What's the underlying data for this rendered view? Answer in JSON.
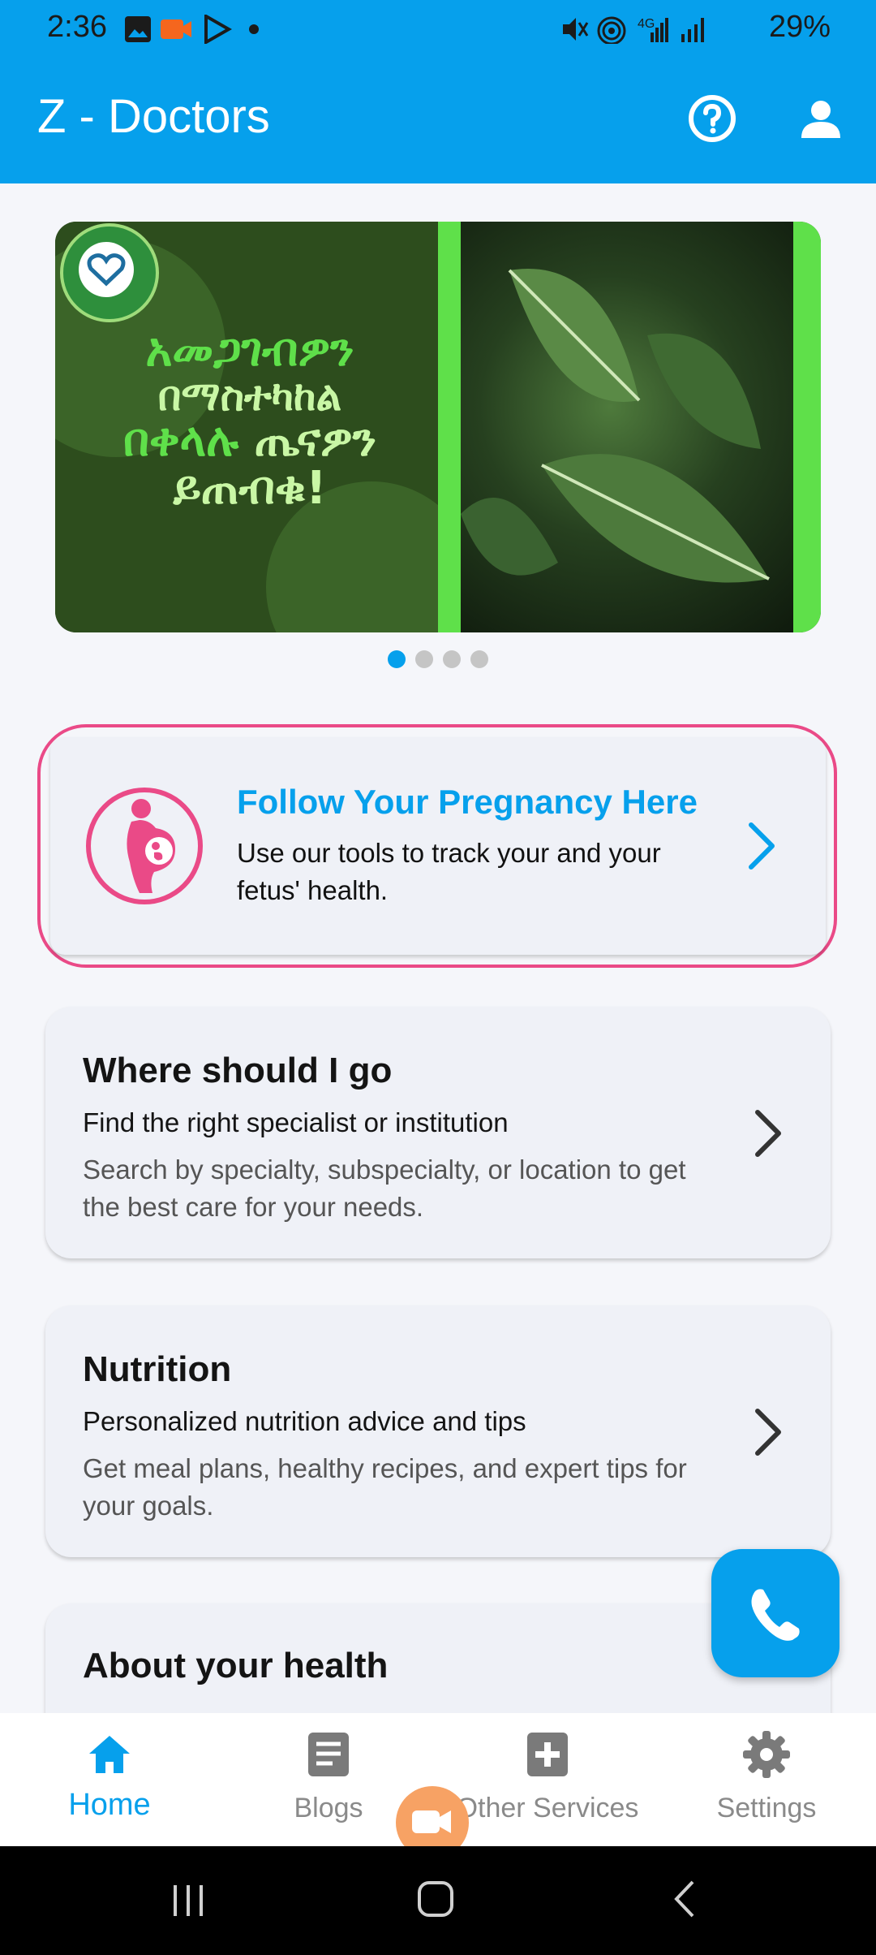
{
  "status": {
    "time": "2:36",
    "battery": "29%"
  },
  "appbar": {
    "title": "Z - Doctors",
    "help_icon": "help-circle-icon",
    "profile_icon": "person-icon"
  },
  "banner": {
    "lines": [
      "አመጋገብዎን",
      "በማስተካከል",
      "በቀላሉ",
      "ጤናዎን",
      "ይጠብቁ!"
    ],
    "slides": 4,
    "active_slide": 1
  },
  "pregnancy": {
    "title": "Follow Your Pregnancy Here",
    "subtitle": "Use our tools to track your and your fetus' health."
  },
  "cards": [
    {
      "title": "Where should I go",
      "subtitle": "Find the right specialist or institution",
      "description": "Search by specialty, subspecialty, or location to get the best care for your needs."
    },
    {
      "title": "Nutrition",
      "subtitle": "Personalized nutrition advice and tips",
      "description": "Get meal plans, healthy recipes, and expert tips for your goals."
    },
    {
      "title": "About your health",
      "subtitle": ""
    }
  ],
  "bottom_nav": [
    {
      "label": "Home",
      "icon": "home-icon"
    },
    {
      "label": "Blogs",
      "icon": "document-icon"
    },
    {
      "label": "Other Services",
      "icon": "plus-box-icon"
    },
    {
      "label": "Settings",
      "icon": "gear-icon"
    }
  ],
  "colors": {
    "primary": "#06a0ec",
    "pink": "#ea4a87",
    "green": "#5fe04a"
  }
}
